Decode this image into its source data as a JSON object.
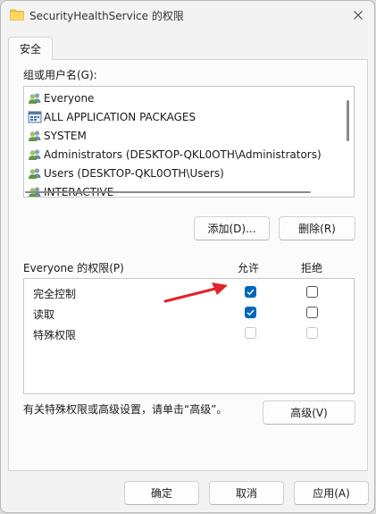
{
  "window": {
    "title": "SecurityHealthService 的权限",
    "colors": {
      "accent": "#0067c0",
      "arrow": "#e0242a"
    }
  },
  "tabs": [
    {
      "label": "安全"
    }
  ],
  "groups": {
    "label": "组或用户名(G):",
    "items": [
      {
        "label": "Everyone",
        "icon": "users-icon"
      },
      {
        "label": "ALL APPLICATION PACKAGES",
        "icon": "app-packages-icon"
      },
      {
        "label": "SYSTEM",
        "icon": "users-icon"
      },
      {
        "label": "Administrators (DESKTOP-QKL0OTH\\Administrators)",
        "icon": "users-icon"
      },
      {
        "label": "Users (DESKTOP-QKL0OTH\\Users)",
        "icon": "users-icon"
      },
      {
        "label": "INTERACTIVE",
        "icon": "users-icon"
      }
    ],
    "add_label": "添加(D)...",
    "remove_label": "删除(R)"
  },
  "permissions": {
    "title": "Everyone 的权限(P)",
    "allow_header": "允许",
    "deny_header": "拒绝",
    "rows": [
      {
        "label": "完全控制",
        "allow": "checked",
        "deny": "unchecked"
      },
      {
        "label": "读取",
        "allow": "checked",
        "deny": "unchecked"
      },
      {
        "label": "特殊权限",
        "allow": "disabled",
        "deny": "disabled"
      }
    ]
  },
  "advanced": {
    "hint": "有关特殊权限或高级设置，请单击“高级”。",
    "button_label": "高级(V)"
  },
  "footer": {
    "ok_label": "确定",
    "cancel_label": "取消",
    "apply_label": "应用(A)"
  }
}
